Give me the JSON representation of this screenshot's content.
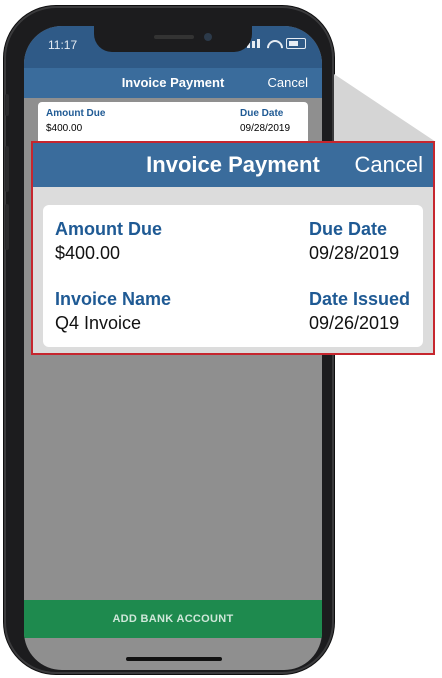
{
  "status_bar": {
    "time": "11:17"
  },
  "navbar": {
    "title": "Invoice Payment",
    "cancel_label": "Cancel"
  },
  "invoice": {
    "amount_due_label": "Amount Due",
    "amount_due_value": "$400.00",
    "due_date_label": "Due Date",
    "due_date_value": "09/28/2019",
    "invoice_name_label": "Invoice Name",
    "invoice_name_value": "Q4 Invoice",
    "date_issued_label": "Date Issued",
    "date_issued_value": "09/26/2019"
  },
  "actions": {
    "add_bank_account_label": "ADD BANK ACCOUNT"
  },
  "colors": {
    "nav_blue": "#3a6c9c",
    "status_blue": "#2f5a87",
    "label_blue": "#1f5a94",
    "action_green": "#1e8a4e",
    "highlight_red": "#c6262e"
  },
  "icons": [
    "signal-icon",
    "wifi-icon",
    "battery-icon"
  ]
}
